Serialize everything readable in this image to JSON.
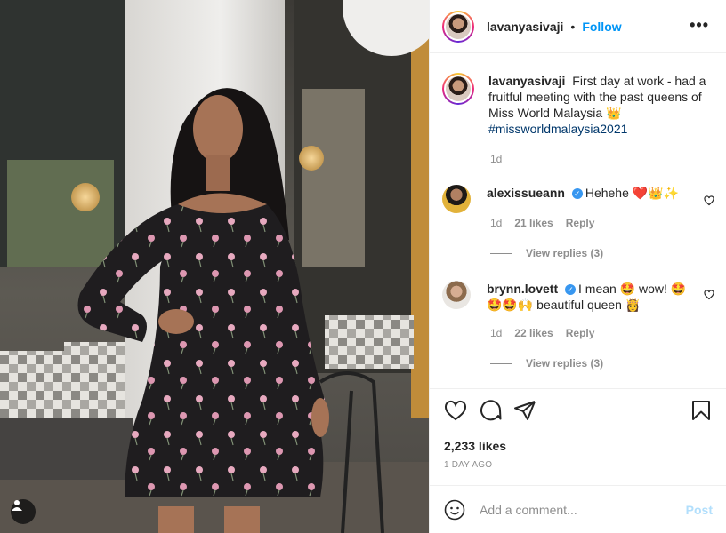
{
  "post": {
    "username": "lavanyasivaji",
    "separator": "•",
    "follow_label": "Follow",
    "more_label": "•••",
    "caption": "First day at work - had a fruitful meeting with the past queens of Miss World Malaysia 👑",
    "hashtag": "#missworldmalaysia2021",
    "caption_age": "1d"
  },
  "comments": [
    {
      "username": "alexissueann",
      "verified": true,
      "text": "Hehehe ❤️👑✨",
      "age": "1d",
      "likes": "21 likes",
      "reply_label": "Reply",
      "view_replies": "View replies (3)"
    },
    {
      "username": "brynn.lovett",
      "verified": true,
      "text": "I mean 🤩 wow! 🤩 🤩🤩🙌 beautiful queen 👸",
      "age": "1d",
      "likes": "22 likes",
      "reply_label": "Reply",
      "view_replies": "View replies (3)"
    }
  ],
  "actions": {
    "icons": [
      "heart-icon",
      "comment-icon",
      "share-icon",
      "bookmark-icon"
    ]
  },
  "likes_count": "2,233 likes",
  "posted_ago": "1 DAY AGO",
  "add_comment": {
    "placeholder": "Add a comment...",
    "post_label": "Post"
  },
  "colors": {
    "link_blue": "#0095f6",
    "hashtag": "#00376b",
    "muted": "#8e8e8e",
    "post_disabled": "#b2dffc"
  }
}
